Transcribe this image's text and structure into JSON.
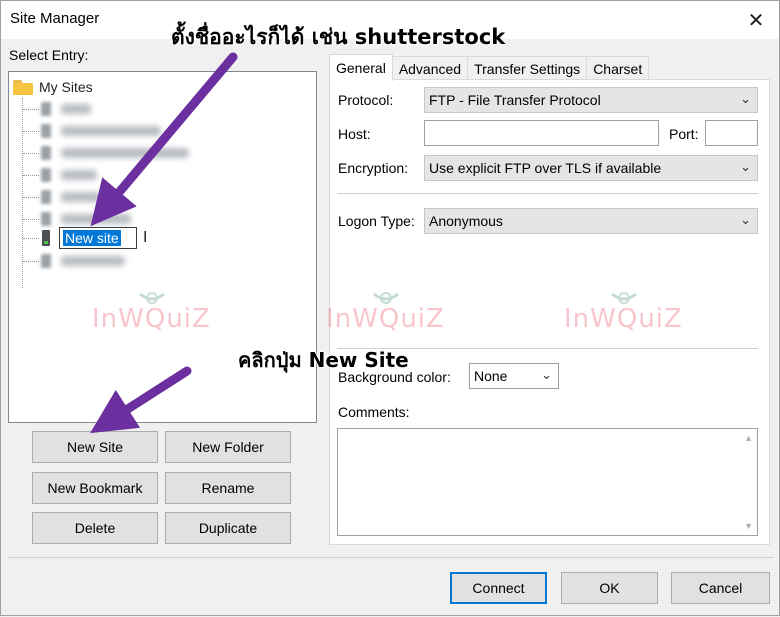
{
  "window": {
    "title": "Site Manager",
    "close_glyph": "✕"
  },
  "left": {
    "select_entry_label": "Select Entry:",
    "tree": {
      "root_label": "My Sites",
      "editing_value": "New site"
    },
    "buttons": {
      "new_site": "New Site",
      "new_folder": "New Folder",
      "new_bookmark": "New Bookmark",
      "rename": "Rename",
      "delete": "Delete",
      "duplicate": "Duplicate"
    }
  },
  "tabs": [
    {
      "label": "General",
      "active": true
    },
    {
      "label": "Advanced",
      "active": false
    },
    {
      "label": "Transfer Settings",
      "active": false
    },
    {
      "label": "Charset",
      "active": false
    }
  ],
  "general": {
    "protocol_label": "Protocol:",
    "protocol_value": "FTP - File Transfer Protocol",
    "host_label": "Host:",
    "host_value": "",
    "port_label": "Port:",
    "port_value": "",
    "encryption_label": "Encryption:",
    "encryption_value": "Use explicit FTP over TLS if available",
    "logon_type_label": "Logon Type:",
    "logon_type_value": "Anonymous",
    "background_color_label": "Background color:",
    "background_color_value": "None",
    "comments_label": "Comments:",
    "comments_value": ""
  },
  "footer": {
    "connect": "Connect",
    "ok": "OK",
    "cancel": "Cancel"
  },
  "watermark": {
    "text": "InWQuiZ"
  },
  "annotations": {
    "top": "ตั้งชื่ออะไรก็ได้ เช่น shutterstock",
    "middle": "คลิกปุ่ม New Site"
  },
  "colors": {
    "accent": "#0078d7",
    "arrow": "#6b2fa0",
    "watermark": "#f08090"
  },
  "icons": {
    "close": "close-icon",
    "folder": "folder-icon",
    "server": "server-icon",
    "chevron": "chevron-down-icon"
  }
}
